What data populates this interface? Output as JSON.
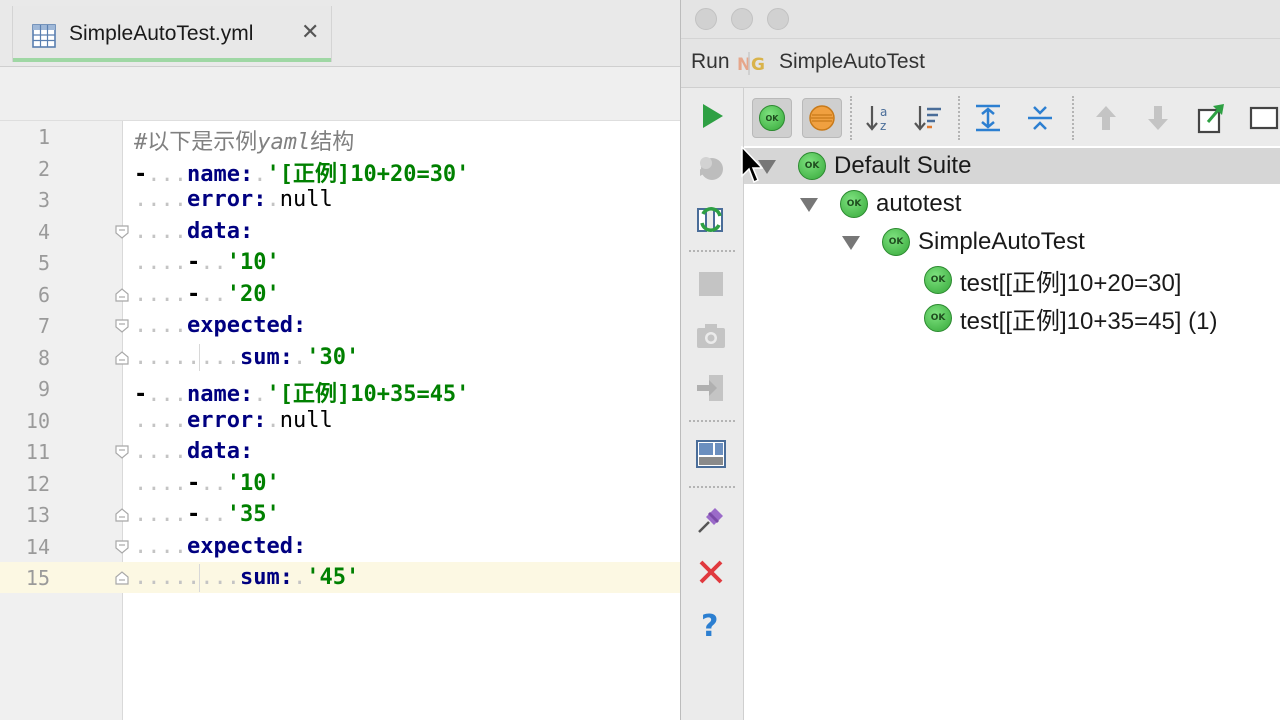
{
  "editor": {
    "tab": {
      "icon": "table-file-icon",
      "label": "SimpleAutoTest.yml",
      "close": "✕"
    },
    "current_line": 15,
    "lines": [
      {
        "n": "1",
        "tokens": [
          {
            "t": "cmt",
            "v": "#以下是示例"
          },
          {
            "t": "cmti",
            "v": "yaml"
          },
          {
            "t": "cmt",
            "v": "结构"
          }
        ]
      },
      {
        "n": "2",
        "tokens": [
          {
            "t": "dash",
            "v": "-"
          },
          {
            "t": "ws",
            "v": "..."
          },
          {
            "t": "key",
            "v": "name:"
          },
          {
            "t": "ws",
            "v": "."
          },
          {
            "t": "str",
            "v": "'[正例]10+20=30'"
          }
        ]
      },
      {
        "n": "3",
        "tokens": [
          {
            "t": "ws",
            "v": "...."
          },
          {
            "t": "key",
            "v": "error:"
          },
          {
            "t": "ws",
            "v": "."
          },
          {
            "t": "plain",
            "v": "null"
          }
        ]
      },
      {
        "n": "4",
        "tokens": [
          {
            "t": "ws",
            "v": "...."
          },
          {
            "t": "key",
            "v": "data:"
          }
        ]
      },
      {
        "n": "5",
        "tokens": [
          {
            "t": "ws",
            "v": "...."
          },
          {
            "t": "dash",
            "v": "-"
          },
          {
            "t": "ws",
            "v": ".."
          },
          {
            "t": "str",
            "v": "'10'"
          }
        ]
      },
      {
        "n": "6",
        "tokens": [
          {
            "t": "ws",
            "v": "...."
          },
          {
            "t": "dash",
            "v": "-"
          },
          {
            "t": "ws",
            "v": ".."
          },
          {
            "t": "str",
            "v": "'20'"
          }
        ]
      },
      {
        "n": "7",
        "tokens": [
          {
            "t": "ws",
            "v": "...."
          },
          {
            "t": "key",
            "v": "expected:"
          }
        ]
      },
      {
        "n": "8",
        "tokens": [
          {
            "t": "ws",
            "v": "........"
          },
          {
            "t": "key",
            "v": "sum:"
          },
          {
            "t": "ws",
            "v": "."
          },
          {
            "t": "str",
            "v": "'30'"
          }
        ]
      },
      {
        "n": "9",
        "tokens": [
          {
            "t": "dash",
            "v": "-"
          },
          {
            "t": "ws",
            "v": "..."
          },
          {
            "t": "key",
            "v": "name:"
          },
          {
            "t": "ws",
            "v": "."
          },
          {
            "t": "str",
            "v": "'[正例]10+35=45'"
          }
        ]
      },
      {
        "n": "10",
        "tokens": [
          {
            "t": "ws",
            "v": "...."
          },
          {
            "t": "key",
            "v": "error:"
          },
          {
            "t": "ws",
            "v": "."
          },
          {
            "t": "plain",
            "v": "null"
          }
        ]
      },
      {
        "n": "11",
        "tokens": [
          {
            "t": "ws",
            "v": "...."
          },
          {
            "t": "key",
            "v": "data:"
          }
        ]
      },
      {
        "n": "12",
        "tokens": [
          {
            "t": "ws",
            "v": "...."
          },
          {
            "t": "dash",
            "v": "-"
          },
          {
            "t": "ws",
            "v": ".."
          },
          {
            "t": "str",
            "v": "'10'"
          }
        ]
      },
      {
        "n": "13",
        "tokens": [
          {
            "t": "ws",
            "v": "...."
          },
          {
            "t": "dash",
            "v": "-"
          },
          {
            "t": "ws",
            "v": ".."
          },
          {
            "t": "str",
            "v": "'35'"
          }
        ]
      },
      {
        "n": "14",
        "tokens": [
          {
            "t": "ws",
            "v": "...."
          },
          {
            "t": "key",
            "v": "expected:"
          }
        ]
      },
      {
        "n": "15",
        "tokens": [
          {
            "t": "ws",
            "v": "........"
          },
          {
            "t": "key",
            "v": "sum:"
          },
          {
            "t": "ws",
            "v": "."
          },
          {
            "t": "str",
            "v": "'45'"
          }
        ]
      }
    ],
    "fold_markers": {
      "4": "open",
      "6": "close",
      "7": "open",
      "8": "close",
      "11": "open",
      "13": "close",
      "14": "open",
      "15": "close"
    }
  },
  "run_window": {
    "run_label": "Run",
    "config_name": "SimpleAutoTest",
    "config_icon": "testng-icon",
    "side_toolbar": [
      "run-icon",
      "debug-icon",
      "rerun-failed-icon",
      "stop-icon",
      "camera-icon",
      "exit-icon",
      "layout-icon",
      "pin-icon",
      "close-icon",
      "help-icon"
    ],
    "top_toolbar": [
      "show-passed-icon",
      "show-ignored-icon",
      "sort-alpha-icon",
      "sort-duration-icon",
      "expand-all-icon",
      "collapse-all-icon",
      "prev-failed-icon",
      "next-failed-icon",
      "export-icon",
      "import-icon"
    ],
    "ok_badge": "OK",
    "tree": [
      {
        "label": "Default Suite",
        "level": 0,
        "expanded": true,
        "selected": true
      },
      {
        "label": "autotest",
        "level": 1,
        "expanded": true
      },
      {
        "label": "SimpleAutoTest",
        "level": 2,
        "expanded": true
      },
      {
        "label": "test[[正例]10+20=30]",
        "level": 3
      },
      {
        "label": "test[[正例]10+35=45] (1)",
        "level": 3
      }
    ]
  },
  "colors": {
    "key": "#000080",
    "string": "#008000",
    "comment": "#808080",
    "ok_green": "#36a83a",
    "run_green": "#2ea043",
    "close_red": "#e0393e",
    "help_blue": "#2c7fd1"
  }
}
